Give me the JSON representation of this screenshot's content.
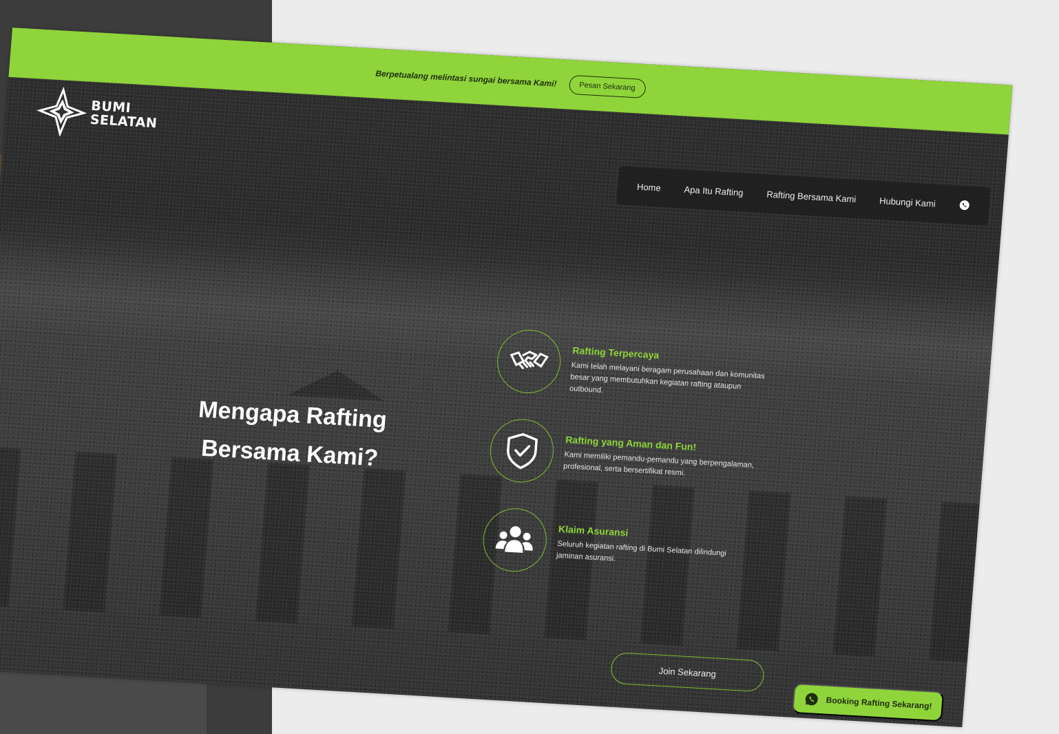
{
  "topbar": {
    "text": "Berpetualang melintasi sungai bersama Kami!",
    "button_label": "Pesan Sekarang"
  },
  "logo": {
    "line1": "BUMI",
    "line2": "SELATAN",
    "icon": "star-diamond-logo"
  },
  "nav": {
    "items": [
      {
        "label": "Home"
      },
      {
        "label": "Apa Itu Rafting"
      },
      {
        "label": "Rafting Bersama Kami"
      },
      {
        "label": "Hubungi Kami"
      }
    ],
    "phone_icon": "whatsapp-icon"
  },
  "hero": {
    "title_line1": "Mengapa Rafting",
    "title_line2": "Bersama Kami?"
  },
  "features": [
    {
      "icon": "handshake-icon",
      "title": "Rafting Terpercaya",
      "desc": "Kami telah melayani beragam perusahaan dan komunitas besar yang membutuhkan kegiatan rafting ataupun outbound."
    },
    {
      "icon": "shield-check-icon",
      "title": "Rafting yang Aman dan Fun!",
      "desc": "Kami memiliki pemandu-pemandu yang berpengalaman, profesional, serta bersertifikat resmi."
    },
    {
      "icon": "users-icon",
      "title": "Klaim Asuransi",
      "desc": "Seluruh kegiatan rafting di Bumi Selatan dilindungi jaminan asuransi."
    }
  ],
  "join_button": "Join Sekarang",
  "whatsapp_button": "Booking Rafting Sekarang!",
  "colors": {
    "accent": "#8fd43a",
    "background": "#333333",
    "text": "#ffffff"
  }
}
